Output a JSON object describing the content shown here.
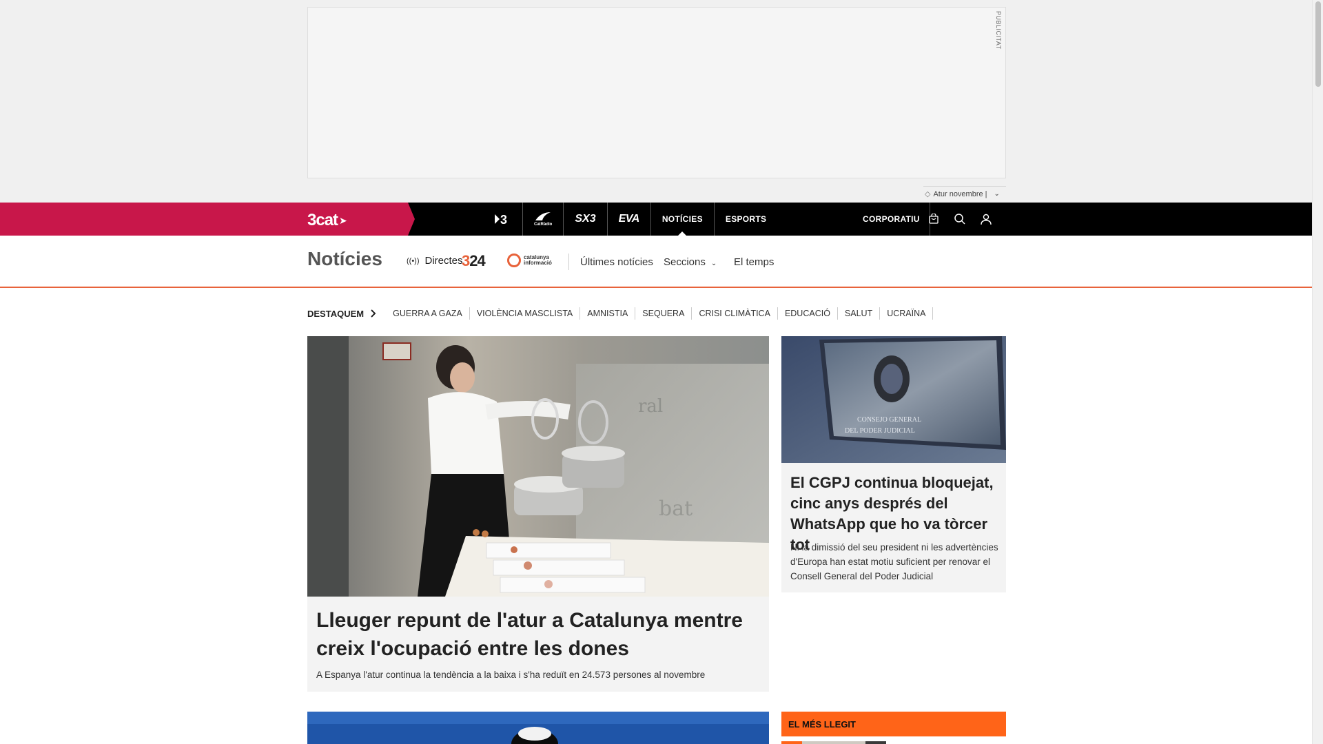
{
  "ad": {
    "label": "PUBLICITAT",
    "tag_text": "Atur novembre |"
  },
  "topnav": {
    "brand": "3cat",
    "channels": [
      {
        "label": "3",
        "kind": "tv3"
      },
      {
        "label": "CatRàdio",
        "kind": "catradio"
      },
      {
        "label": "SX3",
        "kind": "sx3"
      },
      {
        "label": "EVA",
        "kind": "eva"
      },
      {
        "label": "NOTÍCIES",
        "kind": "text",
        "active": true
      },
      {
        "label": "ESPORTS",
        "kind": "text"
      }
    ],
    "corporate": "CORPORATIU",
    "icons": [
      "shopping-bag-icon",
      "search-icon",
      "user-icon"
    ]
  },
  "subheader": {
    "title": "Notícies",
    "live_label": "Directes",
    "logo_324": "324",
    "logo_ci_line1": "catalunya",
    "logo_ci_line2": "informació",
    "latest": "Últimes notícies",
    "sections": "Seccions",
    "weather": "El temps"
  },
  "tags": {
    "heading": "DESTAQUEM",
    "items": [
      "GUERRA A GAZA",
      "VIOLÈNCIA MASCLISTA",
      "AMNISTIA",
      "SEQUERA",
      "CRISI CLIMÀTICA",
      "EDUCACIÓ",
      "SALUT",
      "UCRAÏNA"
    ]
  },
  "main_article": {
    "title": "Lleuger repunt de l'atur a Catalunya mentre creix l'ocupació entre les dones",
    "subtitle": "A Espanya l'atur continua la tendència a la baixa i s'ha reduït en 24.573 persones al novembre"
  },
  "side_article": {
    "title": "El CGPJ continua bloquejat, cinc anys després del WhatsApp que ho va tòrcer tot",
    "subtitle": "Ni la dimissió del seu president ni les advertències d'Europa han estat motiu suficient per renovar el Consell General del Poder Judicial",
    "plaque_line1": "CONSEJO GENERAL",
    "plaque_line2": "DEL PODER JUDICIAL"
  },
  "most_read": {
    "heading": "EL MÉS LLEGIT"
  },
  "colors": {
    "brand_red": "#c8174a",
    "accent_orange": "#ff6418",
    "section_orange": "#e8633b"
  }
}
